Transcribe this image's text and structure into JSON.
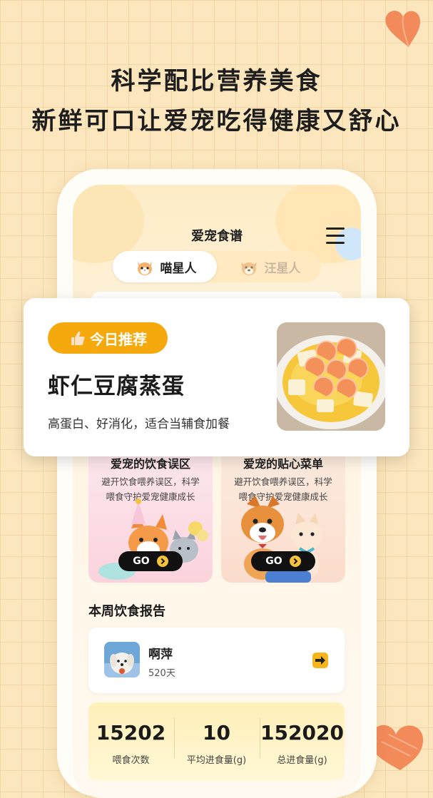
{
  "headline": {
    "line1": "科学配比营养美食",
    "line2": "新鲜可口让爱宠吃得健康又舒心"
  },
  "app": {
    "title": "爱宠食谱",
    "menu_icon": "hamburger-menu-icon"
  },
  "tabs": [
    {
      "label": "喵星人",
      "icon": "cat-icon",
      "active": true
    },
    {
      "label": "汪星人",
      "icon": "dog-icon",
      "active": false
    }
  ],
  "recommend": {
    "badge": "今日推荐",
    "badge_icon": "thumbs-up-icon",
    "title": "虾仁豆腐蒸蛋",
    "desc": "高蛋白、好消化，适合当辅食加餐",
    "image": "shrimp-tofu-steamed-egg-image"
  },
  "features": [
    {
      "title": "爱宠的饮食误区",
      "desc": "避开饮食喂养误区，科学喂食守护爱宠健康成长",
      "button": "GO"
    },
    {
      "title": "爱宠的贴心菜单",
      "desc": "避开饮食喂养误区，科学喂食守护爱宠健康成长",
      "button": "GO"
    }
  ],
  "report": {
    "section_title": "本周饮食报告",
    "user": {
      "name": "啊萍",
      "days": "520天"
    },
    "stats": [
      {
        "value": "15202",
        "label": "喂食次数"
      },
      {
        "value": "10",
        "label": "平均进食量(g)"
      },
      {
        "value": "152020",
        "label": "总进食量(g)"
      }
    ]
  },
  "colors": {
    "accent": "#f6a90d",
    "background": "#fbe6bd",
    "button_dark": "#111111"
  }
}
